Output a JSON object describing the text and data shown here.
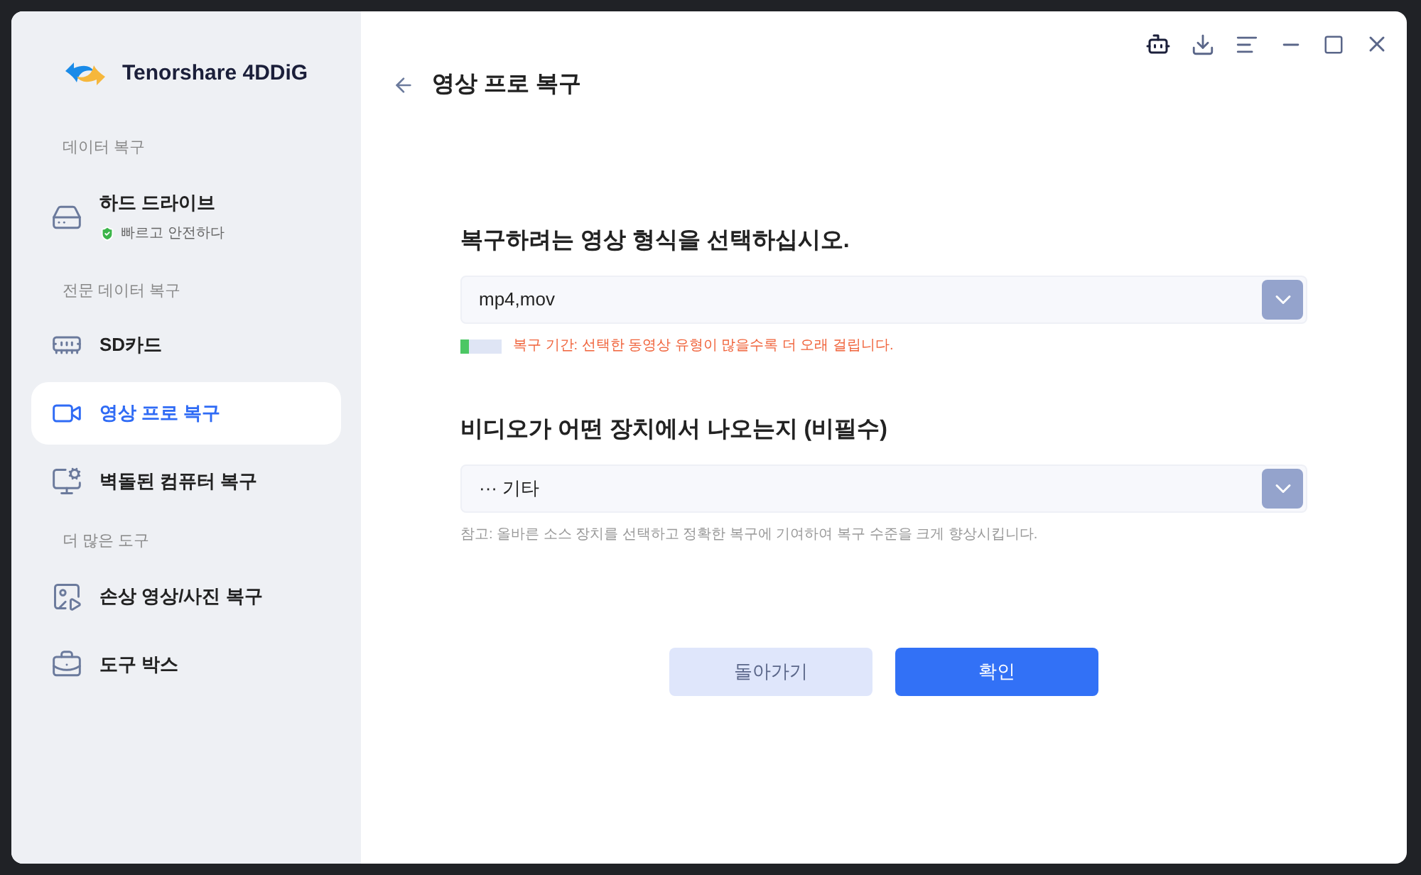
{
  "app": {
    "name": "Tenorshare 4DDiG"
  },
  "sidebar": {
    "sections": [
      {
        "heading": "데이터 복구",
        "items": [
          {
            "kind": "drive",
            "label": "하드 드라이브",
            "subtitle": "빠르고 안전하다",
            "selected": false
          }
        ]
      },
      {
        "heading": "전문 데이터 복구",
        "items": [
          {
            "kind": "sd",
            "label": "SD카드",
            "selected": false
          },
          {
            "kind": "video",
            "label": "영상 프로 복구",
            "selected": true
          },
          {
            "kind": "computer",
            "label": "벽돌된 컴퓨터 복구",
            "selected": false
          }
        ]
      },
      {
        "heading": "더 많은 도구",
        "items": [
          {
            "kind": "repair",
            "label": "손상 영상/사진 복구",
            "selected": false
          },
          {
            "kind": "toolbox",
            "label": "도구 박스",
            "selected": false
          }
        ]
      }
    ]
  },
  "page": {
    "title": "영상 프로 복구"
  },
  "format": {
    "label": "복구하려는 영상 형식을 선택하십시오.",
    "value": "mp4,mov",
    "level": 0.2,
    "duration_note": "복구 기간: 선택한 동영상 유형이 많을수록 더 오래 걸립니다."
  },
  "device": {
    "label": "비디오가 어떤 장치에서 나오는지 (비필수)",
    "value": "··· 기타",
    "note": "참고: 올바른 소스 장치를 선택하고 정확한 복구에 기여하여 복구 수준을 크게 향상시킵니다."
  },
  "buttons": [
    {
      "kind": "secondary",
      "label": "돌아가기"
    },
    {
      "kind": "primary",
      "label": "확인"
    }
  ]
}
